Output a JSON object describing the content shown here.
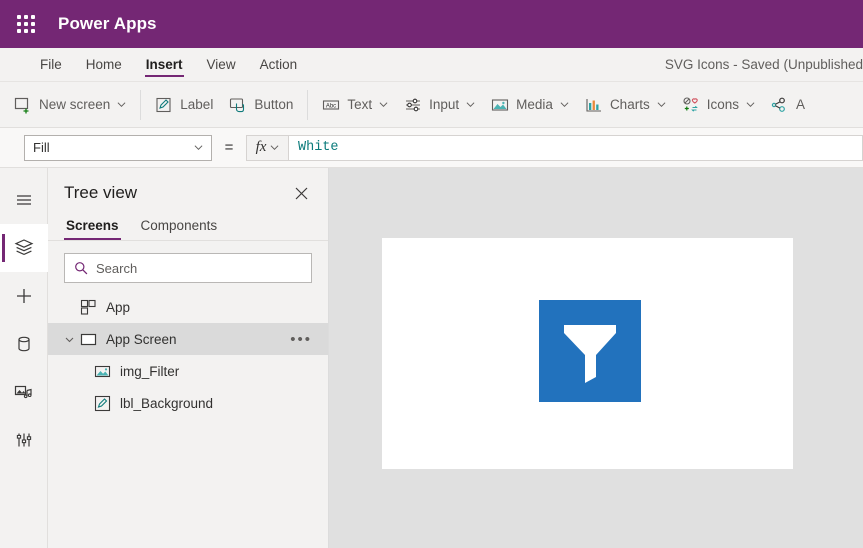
{
  "header": {
    "app_name": "Power Apps",
    "waffle_icon": "waffle-grid-icon",
    "bg_color": "#742774"
  },
  "menubar": {
    "items": [
      {
        "label": "File",
        "active": false
      },
      {
        "label": "Home",
        "active": false
      },
      {
        "label": "Insert",
        "active": true
      },
      {
        "label": "View",
        "active": false
      },
      {
        "label": "Action",
        "active": false
      }
    ],
    "doc_title": "SVG Icons - Saved (Unpublished"
  },
  "ribbon": {
    "items": [
      {
        "label": "New screen",
        "icon": "new-screen-icon",
        "caret": true
      },
      {
        "label": "Label",
        "icon": "label-pencil-icon",
        "caret": false
      },
      {
        "label": "Button",
        "icon": "button-icon",
        "caret": false
      },
      {
        "label": "Text",
        "icon": "text-abc-icon",
        "caret": true
      },
      {
        "label": "Input",
        "icon": "input-sliders-icon",
        "caret": true
      },
      {
        "label": "Media",
        "icon": "media-image-icon",
        "caret": true
      },
      {
        "label": "Charts",
        "icon": "charts-bar-icon",
        "caret": true
      },
      {
        "label": "Icons",
        "icon": "icons-glyph-icon",
        "caret": true
      },
      {
        "label": "A",
        "icon": "ai-builder-icon",
        "caret": false
      }
    ]
  },
  "formula_bar": {
    "property": "Fill",
    "equals": "=",
    "fx_label": "fx",
    "formula": "White",
    "formula_color": "#0b7b7b"
  },
  "rail": {
    "items": [
      {
        "name": "hamburger-menu-icon",
        "selected": false
      },
      {
        "name": "tree-view-icon",
        "selected": true
      },
      {
        "name": "insert-plus-icon",
        "selected": false
      },
      {
        "name": "data-cylinder-icon",
        "selected": false
      },
      {
        "name": "media-library-icon",
        "selected": false
      },
      {
        "name": "advanced-tools-icon",
        "selected": false
      }
    ]
  },
  "tree_view": {
    "title": "Tree view",
    "close_icon": "close-icon",
    "tabs": [
      {
        "label": "Screens",
        "active": true
      },
      {
        "label": "Components",
        "active": false
      }
    ],
    "search": {
      "placeholder": "Search",
      "icon": "search-icon",
      "value": ""
    },
    "rows": [
      {
        "label": "App",
        "icon": "app-grid-icon",
        "level": 0,
        "selected": false,
        "chevron": "",
        "more": ""
      },
      {
        "label": "App Screen",
        "icon": "screen-rect-icon",
        "level": 0,
        "selected": true,
        "chevron": "expanded",
        "more": "•••"
      },
      {
        "label": "img_Filter",
        "icon": "image-control-icon",
        "level": 1,
        "selected": false,
        "chevron": "",
        "more": ""
      },
      {
        "label": "lbl_Background",
        "icon": "label-control-icon",
        "level": 1,
        "selected": false,
        "chevron": "",
        "more": ""
      }
    ]
  },
  "canvas": {
    "background": "#e0e0e0",
    "screen_fill": "#ffffff",
    "image_control": {
      "name": "img_Filter",
      "fill": "#2272bd",
      "glyph": "funnel-filter-icon",
      "glyph_color": "#ffffff"
    }
  }
}
